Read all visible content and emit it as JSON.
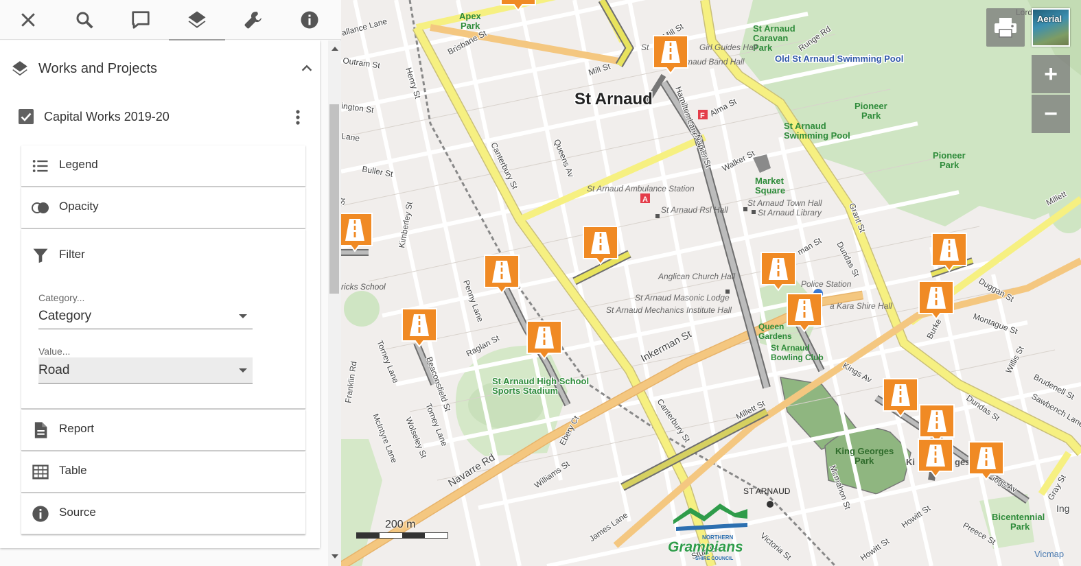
{
  "toolbar": {
    "tools": [
      {
        "name": "close-icon"
      },
      {
        "name": "search-icon"
      },
      {
        "name": "comment-icon"
      },
      {
        "name": "layers-icon",
        "active": true
      },
      {
        "name": "wrench-icon"
      },
      {
        "name": "info-icon"
      }
    ]
  },
  "panel": {
    "group_title": "Works and Projects",
    "layer_title": "Capital Works 2019-20",
    "layer_checked": true,
    "sections": {
      "legend": "Legend",
      "opacity": "Opacity",
      "filter": "Filter",
      "report": "Report",
      "table": "Table",
      "source": "Source"
    },
    "filter": {
      "category_label": "Category...",
      "category_value": "Category",
      "value_label": "Value...",
      "value_value": "Road"
    }
  },
  "map": {
    "controls": {
      "aerial_label": "Aerial",
      "zoom_in": "+",
      "zoom_out": "−"
    },
    "scale_label": "200 m",
    "attribution": "Vicmap",
    "logo": {
      "line1": "NORTHERN",
      "line2": "Grampians",
      "line3": "SHIRE COUNCIL"
    },
    "labels": {
      "town": "St Arnaud",
      "apex_park_1": "Apex",
      "apex_park_2": "Park",
      "caravan_1": "St Arnaud",
      "caravan_2": "Caravan",
      "caravan_3": "Park",
      "old_pool": "Old St Arnaud Swimming Pool",
      "pioneer_park_a_1": "Pioneer",
      "pioneer_park_a_2": "Park",
      "pioneer_park_b_1": "Pioneer",
      "pioneer_park_b_2": "Park",
      "pool_1": "St Arnaud",
      "pool_2": "Swimming Pool",
      "market_1": "Market",
      "market_2": "Square",
      "town_hall": "St Arnaud Town Hall",
      "library": "St Arnaud Library",
      "ambulance": "St Arnaud Ambulance Station",
      "rsl": "St Arnaud Rsl Hall",
      "anglican": "Anglican Church Hall",
      "masonic": "St Arnaud Masonic Lodge",
      "mechanics": "St Arnaud Mechanics Institute Hall",
      "police": "Police Station",
      "shire_hall": "a Kara Shire Hall",
      "queen_1": "Queen",
      "queen_2": "Gardens",
      "bowling_1": "St Arnaud",
      "bowling_2": "Bowling Club",
      "high_school_1": "St Arnaud High School",
      "high_school_2": "Sports Stadium",
      "kings_1": "King Georges",
      "kings_2": "Park",
      "bicentennial_1": "Bicentennial",
      "bicentennial_2": "Park",
      "station": "ST ARNAUD",
      "school": "ricks School",
      "girl_guides": "Girl Guides Hall",
      "band_hall": "maud Band Hall",
      "st_prefix": "St",
      "lord": "Lord",
      "ki": "Ki",
      "ges": "ges",
      "st_canterbury": "Canterbury St",
      "st_canterbury2": "Canterbury St",
      "st_inkerman": "Inkerman St",
      "st_navarre": "Navarre Rd",
      "st_millett": "Millett St",
      "st_millett2": "Millett",
      "st_mill": "Mill St",
      "st_mill2": "Mill St",
      "st_dundas": "Dundas St",
      "st_dundas2": "Dundas St",
      "st_queens": "Queens Av",
      "st_hamilton": "Hamilton Lane",
      "st_napier": "Napier St",
      "st_alma": "Alma St",
      "st_walker": "Walker St",
      "st_grant": "Grant St",
      "st_kings": "Kings Av",
      "st_kings2": "ings Av",
      "st_duggan": "Duggan St",
      "st_montague": "Montague St",
      "st_willis": "Willis St",
      "st_brudenell": "Brudenell St",
      "st_sawbench": "Sawbench Lane",
      "st_burke": "Burke",
      "st_gray": "Gray St",
      "st_ing": "Ing",
      "st_penny": "Penny Lane",
      "st_raglan": "Raglan St",
      "st_beaconsfield": "Beaconsfield St",
      "st_torney": "Torney Lane",
      "st_torney2": "Torney Lane",
      "st_wolseley": "Wolseley St",
      "st_mcintyre": "McIntyre Lane",
      "st_franklin": "Franklin Rd",
      "st_kimberley": "Kimberley St",
      "st_buller": "Buller St",
      "st_henry": "Henry St",
      "st_brisbane": "Brisbane St",
      "st_outram": "Outram St",
      "st_wallance": "allance Lane",
      "st_ington": "ington St",
      "st_lane": "Lane",
      "st_ebery": "Ebery Ct",
      "st_williams": "Williams St",
      "st_james": "James Lane",
      "st_victoria": "Victoria St",
      "st_sturt": "Sturt St",
      "st_mcmahon": "Mcmahon St",
      "st_howitt": "Howitt St",
      "st_howitt2": "Howitt St",
      "st_preece": "Preece St",
      "st_runge": "Runge Rd",
      "st_man": "man St",
      "st_st": "St"
    }
  }
}
